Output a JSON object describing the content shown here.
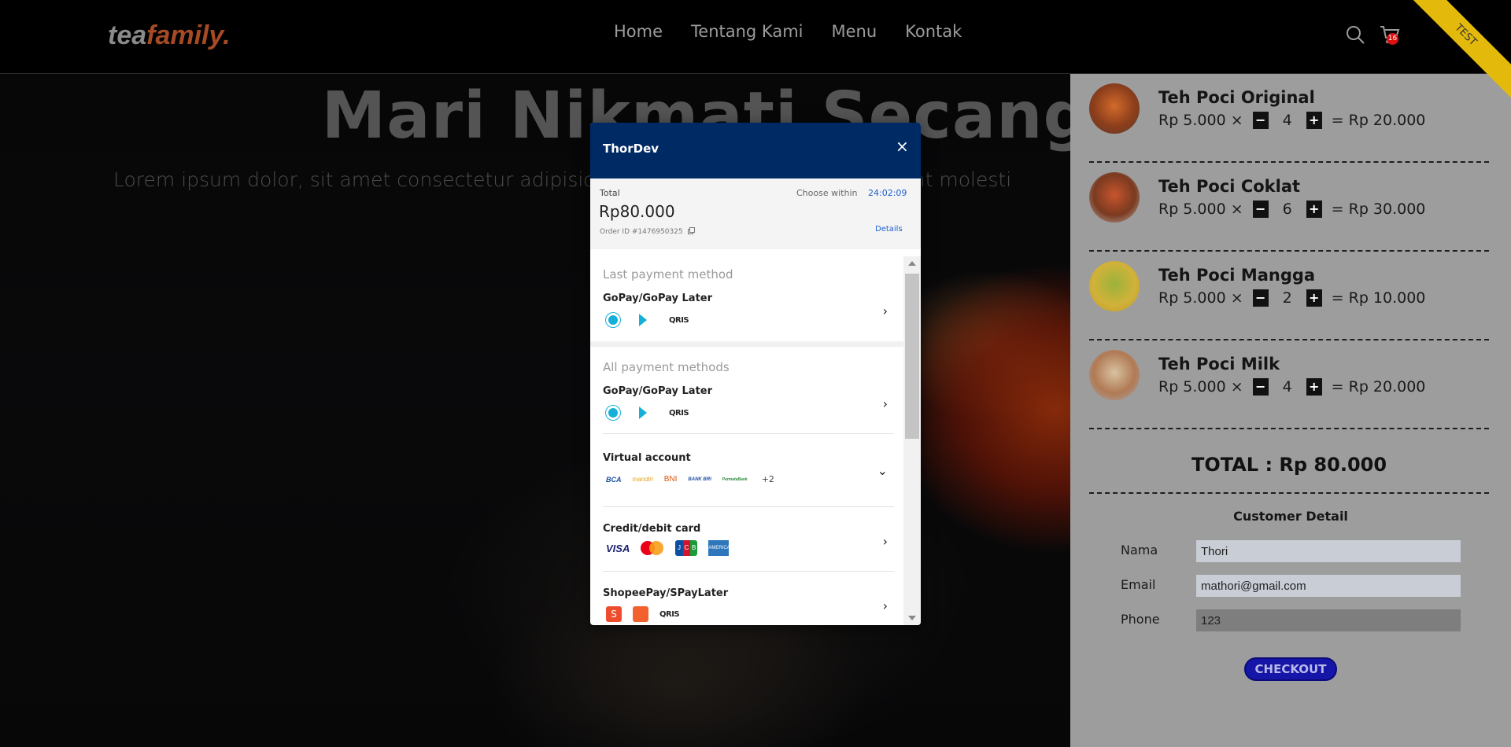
{
  "navbar": {
    "logo_part1": "tea",
    "logo_part2": "family.",
    "links": [
      "Home",
      "Tentang Kami",
      "Menu",
      "Kontak"
    ],
    "cart_count": "16",
    "ribbon": "TEST"
  },
  "hero": {
    "title": "Mari Nikmati Secangkir",
    "subtitle": "Lorem ipsum dolor, sit amet consectetur adipisicing elit. Quisquam ipsam deserunt molesti"
  },
  "cart": {
    "items": [
      {
        "name": "Teh Poci Original",
        "price": "Rp 5.000 ×",
        "qty": "4",
        "subtotal": "= Rp 20.000",
        "minus": "−",
        "plus": "+"
      },
      {
        "name": "Teh Poci Coklat",
        "price": "Rp 5.000 ×",
        "qty": "6",
        "subtotal": "= Rp 30.000",
        "minus": "−",
        "plus": "+"
      },
      {
        "name": "Teh Poci Mangga",
        "price": "Rp 5.000 ×",
        "qty": "2",
        "subtotal": "= Rp 10.000",
        "minus": "−",
        "plus": "+"
      },
      {
        "name": "Teh Poci Milk",
        "price": "Rp 5.000 ×",
        "qty": "4",
        "subtotal": "= Rp 20.000",
        "minus": "−",
        "plus": "+"
      }
    ],
    "total": "TOTAL : Rp 80.000",
    "customer_title": "Customer Detail",
    "fields": [
      {
        "label": "Nama",
        "value": "Thori"
      },
      {
        "label": "Email",
        "value": "mathori@gmail.com"
      },
      {
        "label": "Phone",
        "value": "123"
      }
    ],
    "checkout_label": "CHECKOUT"
  },
  "modal": {
    "title": "ThorDev",
    "close": "×",
    "total_label": "Total",
    "amount": "Rp80.000",
    "order_id": "Order ID #1476950325",
    "choose_within": "Choose within",
    "timer": "24:02:09",
    "details": "Details",
    "last_section": "Last payment method",
    "all_section": "All payment methods",
    "methods": {
      "last_gopay": "GoPay/GoPay Later",
      "gopay": "GoPay/GoPay Later",
      "va": "Virtual account",
      "card": "Credit/debit card",
      "shopee": "ShopeePay/SPayLater"
    },
    "icon_text": {
      "qris": "QRIS",
      "bca": "BCA",
      "mandiri": "mandiri",
      "bni": "BNI",
      "bri": "BANK BRI",
      "permata": "PermataBank",
      "more": "+2",
      "visa": "VISA",
      "jcb": [
        "J",
        "C",
        "B"
      ],
      "amex": "AMERICAN EXPRESS",
      "shopee": "S"
    }
  },
  "colors": {
    "modal_header": "#002a63",
    "accent_link": "#1e5fcf",
    "checkout_button": "#1515a8",
    "logo_accent": "#a54a25"
  }
}
